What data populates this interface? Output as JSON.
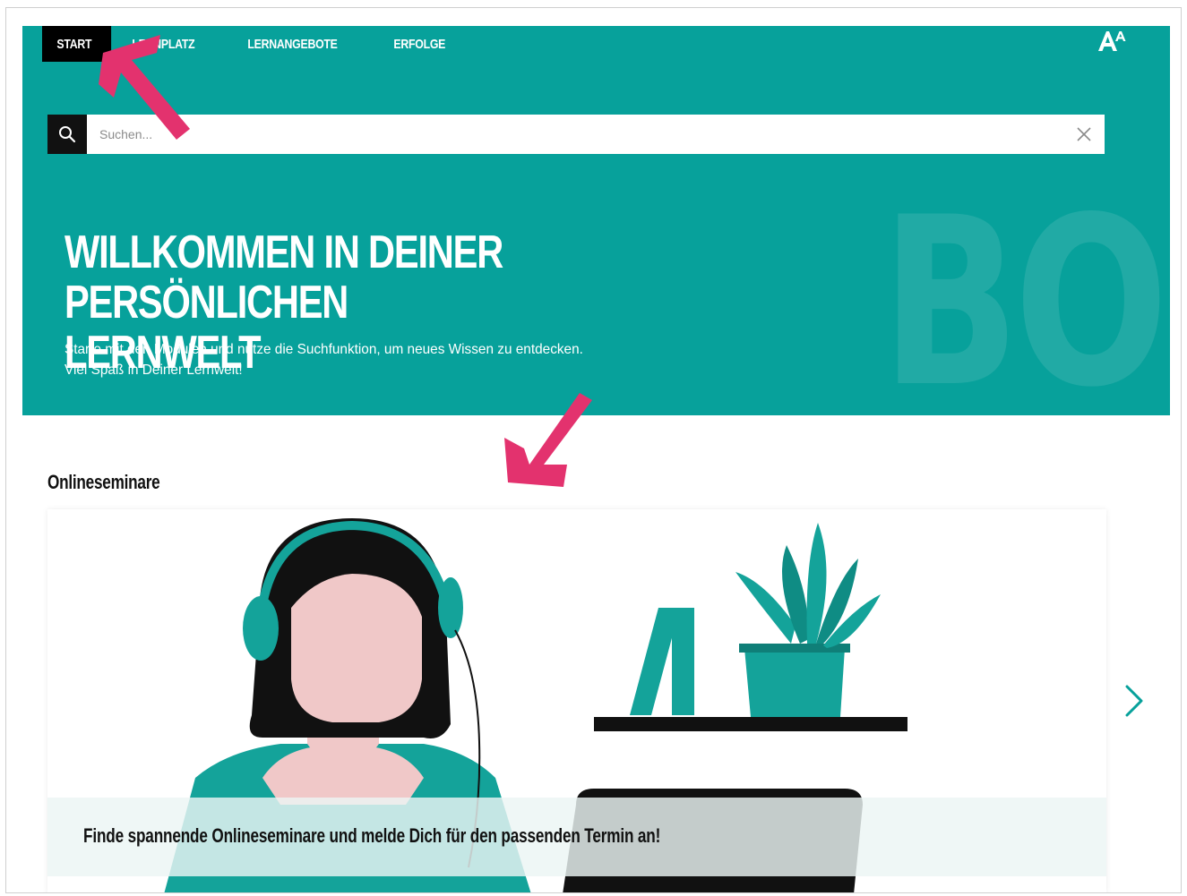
{
  "nav": {
    "items": [
      {
        "label": "START",
        "active": true
      },
      {
        "label": "LERNPLATZ",
        "active": false
      },
      {
        "label": "LERNANGEBOTE",
        "active": false
      },
      {
        "label": "ERFOLGE",
        "active": false
      }
    ],
    "font_size_icon": "font-size-toggle-icon"
  },
  "search": {
    "placeholder": "Suchen...",
    "value": "",
    "search_icon": "search-icon",
    "clear_icon": "close-icon"
  },
  "hero": {
    "title_line1": "WILLKOMMEN IN DEINER PERSÖNLICHEN",
    "title_line2": "LERNWELT",
    "subtitle_line1": "Starte mit den Modulen und nutze die Suchfunktion, um neues Wissen zu entdecken.",
    "subtitle_line2": "Viel Spaß in Deiner Lernwelt!",
    "background_letters": "BO"
  },
  "section": {
    "title": "Onlineseminare",
    "card": {
      "caption": "Finde spannende Onlineseminare und melde Dich für den passenden Termin an!",
      "illustration": "woman-with-headset-and-plant-shelf"
    },
    "next_icon": "chevron-right-icon"
  },
  "colors": {
    "brand_teal": "#07a19b",
    "nav_active": "#000000",
    "annotation_pink": "#e3326e"
  }
}
